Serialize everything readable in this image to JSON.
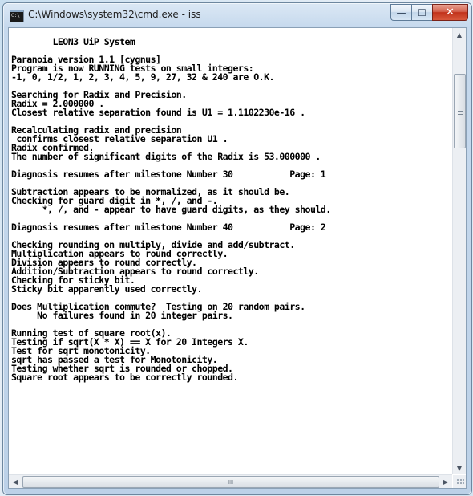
{
  "window": {
    "title": "C:\\Windows\\system32\\cmd.exe - iss",
    "icon_label": "C:\\",
    "buttons": {
      "minimize": "—",
      "maximize": "☐",
      "close": "✕"
    }
  },
  "console": {
    "lines": [
      "",
      "        LEON3 UiP System",
      "",
      "Paranoia version 1.1 [cygnus]",
      "Program is now RUNNING tests on small integers:",
      "-1, 0, 1/2, 1, 2, 3, 4, 5, 9, 27, 32 & 240 are O.K.",
      "",
      "Searching for Radix and Precision.",
      "Radix = 2.000000 .",
      "Closest relative separation found is U1 = 1.1102230e-16 .",
      "",
      "Recalculating radix and precision",
      " confirms closest relative separation U1 .",
      "Radix confirmed.",
      "The number of significant digits of the Radix is 53.000000 .",
      "",
      "Diagnosis resumes after milestone Number 30           Page: 1",
      "",
      "Subtraction appears to be normalized, as it should be.",
      "Checking for guard digit in *, /, and -.",
      "      *, /, and - appear to have guard digits, as they should.",
      "",
      "Diagnosis resumes after milestone Number 40           Page: 2",
      "",
      "Checking rounding on multiply, divide and add/subtract.",
      "Multiplication appears to round correctly.",
      "Division appears to round correctly.",
      "Addition/Subtraction appears to round correctly.",
      "Checking for sticky bit.",
      "Sticky bit apparently used correctly.",
      "",
      "Does Multiplication commute?  Testing on 20 random pairs.",
      "     No failures found in 20 integer pairs.",
      "",
      "Running test of square root(x).",
      "Testing if sqrt(X * X) == X for 20 Integers X.",
      "Test for sqrt monotonicity.",
      "sqrt has passed a test for Monotonicity.",
      "Testing whether sqrt is rounded or chopped.",
      "Square root appears to be correctly rounded."
    ]
  },
  "scrollbars": {
    "up_arrow": "▲",
    "down_arrow": "▼",
    "left_arrow": "◀",
    "right_arrow": "▶",
    "h_thumb_grip": "III"
  }
}
